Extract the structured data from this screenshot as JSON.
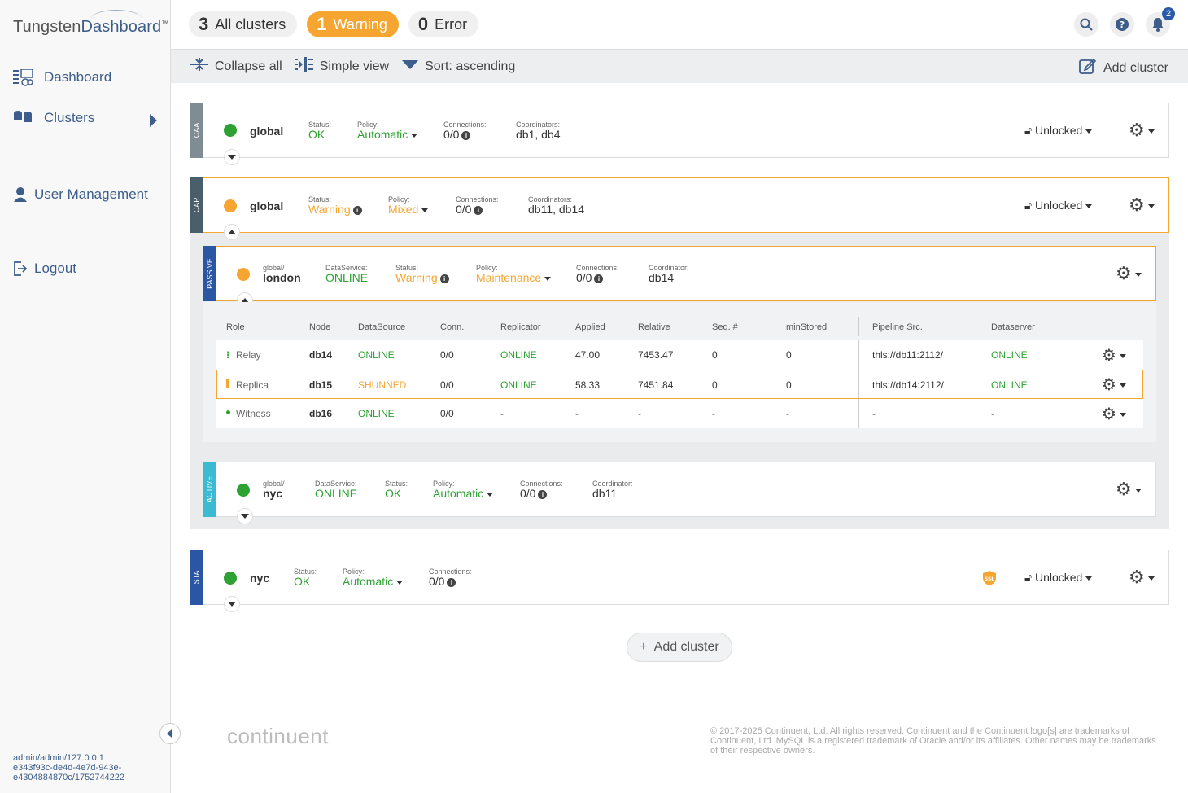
{
  "app": {
    "logo_part1": "Tungsten",
    "logo_part2": "Dashboard",
    "tm": "™"
  },
  "sidebar": {
    "items": [
      {
        "label": "Dashboard"
      },
      {
        "label": "Clusters"
      },
      {
        "label": "User Management"
      },
      {
        "label": "Logout"
      }
    ],
    "userinfo": [
      "admin/admin/127.0.0.1",
      "e343f93c-de4d-4e7d-943e-",
      "e4304884870c/1752744222"
    ]
  },
  "topbar": {
    "all_count": "3",
    "all_label": "All clusters",
    "warn_count": "1",
    "warn_label": "Warning",
    "err_count": "0",
    "err_label": "Error",
    "notif_count": "2"
  },
  "toolbar": {
    "collapse": "Collapse all",
    "simple": "Simple view",
    "sort": "Sort: ascending",
    "add": "Add cluster"
  },
  "labels": {
    "status": "Status:",
    "policy": "Policy:",
    "connections": "Connections:",
    "coordinators": "Coordinators:",
    "coordinator": "Coordinator:",
    "dataservice": "DataService:",
    "unlocked": "Unlocked"
  },
  "clusters": [
    {
      "tag": "CAA",
      "name": "global",
      "status": "OK",
      "policy": "Automatic",
      "connections": "0/0",
      "coordinators": "db1, db4"
    },
    {
      "tag": "CAP",
      "name": "global",
      "status": "Warning",
      "policy": "Mixed",
      "connections": "0/0",
      "coordinators": "db11, db14"
    },
    {
      "tag": "STA",
      "name": "nyc",
      "status": "OK",
      "policy": "Automatic",
      "connections": "0/0"
    }
  ],
  "subclusters": [
    {
      "tag": "PASSIVE",
      "prefix": "global/",
      "name": "london",
      "dataservice": "ONLINE",
      "status": "Warning",
      "policy": "Maintenance",
      "connections": "0/0",
      "coordinator": "db14"
    },
    {
      "tag": "ACTIVE",
      "prefix": "global/",
      "name": "nyc",
      "dataservice": "ONLINE",
      "status": "OK",
      "policy": "Automatic",
      "connections": "0/0",
      "coordinator": "db11"
    }
  ],
  "table": {
    "headers": [
      "Role",
      "Node",
      "DataSource",
      "Conn.",
      "Replicator",
      "Applied",
      "Relative",
      "Seq. #",
      "minStored",
      "Pipeline Src.",
      "Dataserver"
    ],
    "rows": [
      {
        "role": "Relay",
        "node": "db14",
        "ds": "ONLINE",
        "conn": "0/0",
        "rep": "ONLINE",
        "applied": "47.00",
        "relative": "7453.47",
        "seq": "0",
        "min": "0",
        "pipe": "thls://db11:2112/",
        "dsrv": "ONLINE"
      },
      {
        "role": "Replica",
        "node": "db15",
        "ds": "SHUNNED",
        "conn": "0/0",
        "rep": "ONLINE",
        "applied": "58.33",
        "relative": "7451.84",
        "seq": "0",
        "min": "0",
        "pipe": "thls://db14:2112/",
        "dsrv": "ONLINE"
      },
      {
        "role": "Witness",
        "node": "db16",
        "ds": "ONLINE",
        "conn": "0/0",
        "rep": "-",
        "applied": "-",
        "relative": "-",
        "seq": "-",
        "min": "-",
        "pipe": "-",
        "dsrv": "-"
      }
    ]
  },
  "bottom": {
    "add_cluster": "Add cluster",
    "footer_logo": "continuent",
    "copyright": "© 2017-2025 Continuent, Ltd. All rights reserved. Continuent and the Continuent logo[s] are trademarks of Continuent, Ltd. MySQL is a registered trademark of Oracle and/or its affiliates. Other names may be trademarks of their respective owners."
  },
  "colors": {
    "ok": "#2ea133",
    "warning": "#f7a531",
    "brand": "#3d5d8a",
    "caa_tag": "#7f8c94",
    "cap_tag": "#4a5f6b",
    "passive_tag": "#2b56a3",
    "active_tag": "#3bbad1",
    "sta_tag": "#2b56a3"
  }
}
